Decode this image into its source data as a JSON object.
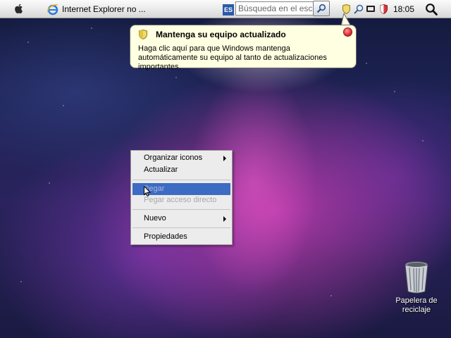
{
  "taskbar": {
    "task_button_label": "Internet Explorer no ...",
    "language": "ES",
    "search_placeholder": "Búsqueda en el escrito",
    "clock": "18:05"
  },
  "balloon": {
    "title": "Mantenga su equipo actualizado",
    "body": "Haga clic aquí para que Windows mantenga automáticamente su equipo al tanto de actualizaciones importantes."
  },
  "context_menu": {
    "items": [
      {
        "label": "Organizar iconos",
        "submenu": true,
        "enabled": true
      },
      {
        "label": "Actualizar",
        "submenu": false,
        "enabled": true
      },
      {
        "label": "Pegar",
        "submenu": false,
        "enabled": false,
        "highlighted": true
      },
      {
        "label": "Pegar acceso directo",
        "submenu": false,
        "enabled": false
      },
      {
        "label": "Nuevo",
        "submenu": true,
        "enabled": true
      },
      {
        "label": "Propiedades",
        "submenu": false,
        "enabled": true
      }
    ]
  },
  "desktop": {
    "recycle_bin_label": "Papelera de reciclaje"
  },
  "icons": {
    "apple_menu": "apple-icon",
    "browser": "internet-explorer-icon",
    "search": "magnifier-icon",
    "spotlight": "spotlight-icon",
    "security": "security-shield-icon"
  },
  "colors": {
    "balloon_background": "#ffffe1",
    "menu_highlight": "#3d6bc4"
  }
}
